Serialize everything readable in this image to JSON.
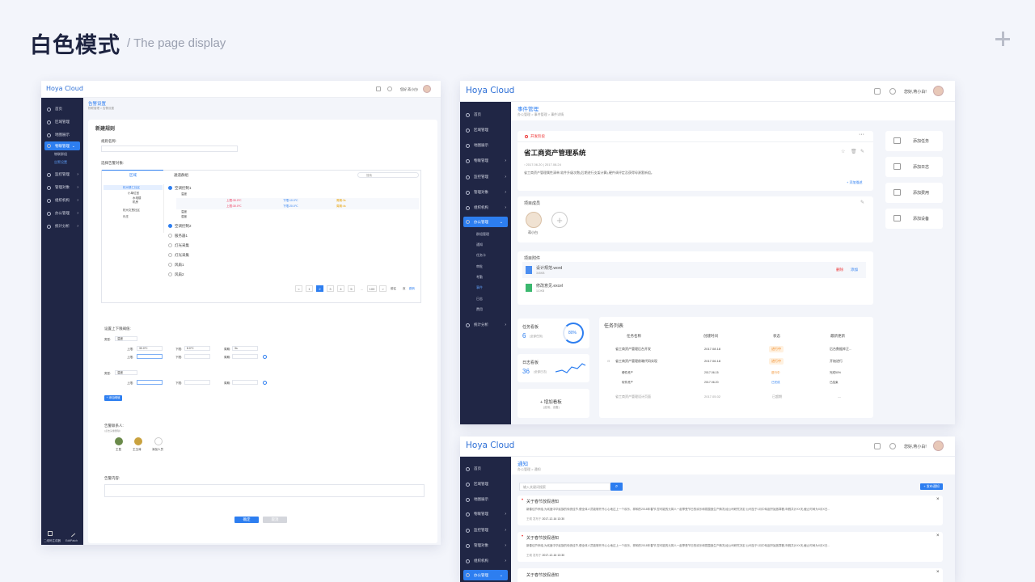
{
  "header": {
    "title": "白色模式",
    "subtitle": "/ The page display"
  },
  "brand": "Hoya Cloud",
  "user_greeting": "您好,蒋小白!",
  "nav": [
    "首页",
    "区域管理",
    "地图展示",
    "物联管理",
    "监控管理",
    "管理对象",
    "组织机构",
    "办公管理",
    "统计分析"
  ],
  "s1": {
    "breadcrumb_title": "告警设置",
    "breadcrumb": [
      "物联管理",
      ">",
      "告警设置"
    ],
    "sub_items": [
      "物联群组",
      "告警设置"
    ],
    "footer": [
      "二维码生成器",
      "EditPatch"
    ],
    "section_title": "新建规则",
    "rule_name_label": "规则名称:",
    "select_label": "选择告警对象:",
    "tabs": [
      "区域",
      "通道群组"
    ],
    "search_placeholder": "搜索",
    "tree": [
      "杭州慧仁社区",
      "小单位宫",
      "水电楼",
      "机房",
      "杭州文慧社区",
      "乐庄"
    ],
    "items": [
      "空调控制1",
      "空调控制2",
      "服务器1",
      "灯光采集",
      "灯光采集",
      "风扇1",
      "风扇2"
    ],
    "temp_rows": [
      [
        "温度",
        "上限:",
        "30.0℃",
        "下限:",
        "10.0℃",
        "周期:",
        "3s"
      ],
      [
        "湿度",
        "上限:",
        "30.0℃",
        "下限:",
        "20.0℃",
        "周期:",
        "4s"
      ]
    ],
    "row_labels": [
      "温度",
      "湿度",
      "温度",
      "湿度"
    ],
    "pages": [
      "<",
      "1",
      "2",
      "3",
      "4",
      "5",
      "...",
      "100",
      ">",
      "前往",
      "页",
      "跳转"
    ],
    "threshold_label": "设置上下限阈值:",
    "type_label": "类型:",
    "type_value": "温度",
    "upper": "上限:",
    "lower": "下限:",
    "period": "周期:",
    "v1": "30.0℃",
    "v2": "8.0℃",
    "v3": "3s",
    "add_btn": "+ 添加阈值",
    "contact_label": "告警联系人:",
    "contact_hint": "(点击头像删除)",
    "contacts": [
      "王昆",
      "王玉涛",
      "添加人员"
    ],
    "content_label": "告警内容:",
    "ok": "确定",
    "cancel": "取消"
  },
  "s2": {
    "page_title": "事件管理",
    "breadcrumb": [
      "办公管理",
      ">",
      "事件管理",
      ">",
      "事件详情"
    ],
    "sub_items": [
      "群组管理",
      "通知",
      "任务卡",
      "审批",
      "考勤",
      "事件",
      "日志",
      "费用"
    ],
    "status": "开发阶段",
    "title": "省工商资产管理系统",
    "date1": "2017.06.20",
    "date2": "2017.08.24",
    "desc": "省工商资产管理属性清单,软件升级次数(后期进行支架计算),硬件调评定及获得母源套新组。",
    "more": "+ 添加描述",
    "members_title": "项目成员",
    "member_name": "蒋小白",
    "attach_title": "项目附件",
    "files": [
      {
        "name": "设计规范.word",
        "size": "345KB"
      },
      {
        "name": "修改意见.excel",
        "size": "110KB"
      }
    ],
    "del": "删除",
    "add": "添加",
    "stat1": {
      "label": "任务看板",
      "num": "6",
      "unit": "(全部任务)",
      "pct": "80%"
    },
    "stat2": {
      "label": "日志看板",
      "num": "36",
      "unit": "(全部日志)"
    },
    "add_board": "+ 增加看板",
    "add_board_sub": "(费用、设备)",
    "task_title": "任务列表",
    "cols": [
      "任务名称",
      "创建时间",
      "状态",
      "最新更新"
    ],
    "rows": [
      [
        "省工商资产管理后台开发",
        "2017.08.18",
        "进行中",
        "后台数据库正..."
      ],
      [
        "省工商资产管理前端代码实现",
        "2017.06.18",
        "进行中",
        "开始进行"
      ],
      [
        "硬件资产",
        "2017.06.15",
        "进行中",
        "完成50%"
      ],
      [
        "软件资产",
        "2017.06.20",
        "已完成",
        "已结束"
      ],
      [
        "省工商资产管理设计页面",
        "2017.05.02",
        "已超期",
        "—"
      ]
    ],
    "actions": [
      "添加任务",
      "添加日志",
      "添加费用",
      "添加设备"
    ]
  },
  "s3": {
    "page_title": "通知",
    "breadcrumb": [
      "办公管理",
      ">",
      "通知"
    ],
    "search_placeholder": "输入关键词搜索",
    "publish": "+ 发布通知",
    "notices": [
      {
        "title": "关于春节放假通知",
        "body": "新春佳节来临,为欢度中华民族的传统佳节,便全体人员能够开开心心地过上一个欢乐、祥和的2018年春节,您可能的元宵人一起享受节日的欢乐和氛围造生产情况,经公司研究决定:公司至于1月中旬起开始放寒假,年假共计XX天,截止时间为X月X日...",
        "author": "王硕",
        "dept": "发布于",
        "time": "2017-12-16 13:30"
      },
      {
        "title": "关于春节放假通知",
        "body": "新春佳节来临,为欢度中华民族的传统佳节,便全体人员能够开开心心地过上一个欢乐、祥和的2018年春节,您可能的元宵人一起享受节日的欢乐和氛围造生产情况,经公司研究决定:公司至于1月中旬起开始放寒假,年假共计XX天,截止时间为X月X日...",
        "author": "王硕",
        "dept": "发布于",
        "time": "2017-12-16 13:30"
      },
      {
        "title": "关于春节放假通知"
      }
    ]
  }
}
